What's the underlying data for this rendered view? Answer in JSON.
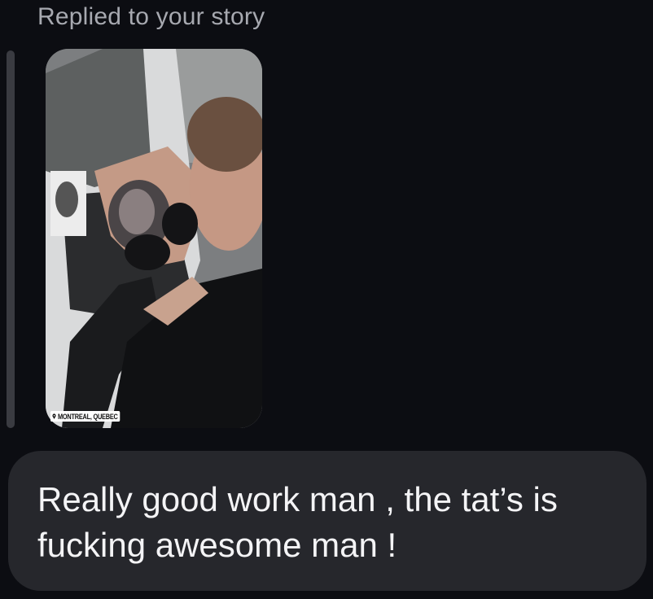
{
  "reply": {
    "label": "Replied to your story"
  },
  "story": {
    "location_tag": "MONTREAL, QUEBEC",
    "location_icon": "map-pin-icon"
  },
  "message": {
    "text": "Really good work man , the tat’s is\nfucking awesome man !"
  },
  "colors": {
    "background": "#0c0d12",
    "bubble": "#26272c",
    "muted_text": "#a7a9b0",
    "message_text": "#f4f4f6"
  }
}
